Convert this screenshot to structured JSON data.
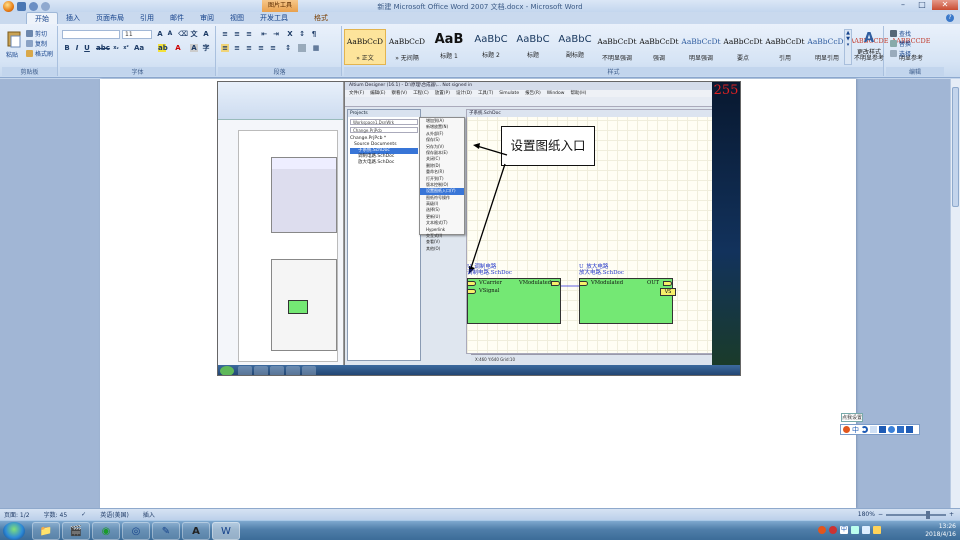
{
  "window": {
    "title": "新建 Microsoft Office Word 2007 文档.docx - Microsoft Word",
    "context_tab_group": "图片工具"
  },
  "ribbon_tabs": [
    "开始",
    "插入",
    "页面布局",
    "引用",
    "邮件",
    "审阅",
    "视图",
    "开发工具",
    "格式"
  ],
  "clipboard": {
    "paste": "粘贴",
    "cut": "剪切",
    "copy": "复制",
    "format_painter": "格式刷",
    "group_label": "剪贴板"
  },
  "font": {
    "size": "11",
    "group_label": "字体"
  },
  "paragraph": {
    "group_label": "段落"
  },
  "styles": {
    "group_label": "样式",
    "change_styles": "更改样式",
    "items": [
      {
        "sample": "AaBbCcD",
        "name": "» 正文",
        "kind": "normal",
        "selected": true
      },
      {
        "sample": "AaBbCcD",
        "name": "» 无间隔",
        "kind": "normal",
        "selected": false
      },
      {
        "sample": "AaB",
        "name": "标题 1",
        "kind": "big",
        "selected": false
      },
      {
        "sample": "AaBbC",
        "name": "标题 2",
        "kind": "big2",
        "selected": false
      },
      {
        "sample": "AaBbC",
        "name": "标题",
        "kind": "big2",
        "selected": false
      },
      {
        "sample": "AaBbC",
        "name": "副标题",
        "kind": "big2",
        "selected": false
      },
      {
        "sample": "AaBbCcDt",
        "name": "不明显强调",
        "kind": "small",
        "selected": false
      },
      {
        "sample": "AaBbCcDt",
        "name": "强调",
        "kind": "small",
        "selected": false
      },
      {
        "sample": "AaBbCcDt",
        "name": "明显强调",
        "kind": "blue",
        "selected": false
      },
      {
        "sample": "AaBbCcDt",
        "name": "要点",
        "kind": "small",
        "selected": false
      },
      {
        "sample": "AaBbCcDt",
        "name": "引用",
        "kind": "small",
        "selected": false
      },
      {
        "sample": "AaBbCcDt",
        "name": "明显引用",
        "kind": "blue",
        "selected": false
      },
      {
        "sample": "AABBCCDE",
        "name": "不明显参考",
        "kind": "red",
        "selected": false
      },
      {
        "sample": "AABBCCDE",
        "name": "明显参考",
        "kind": "red",
        "selected": false
      }
    ]
  },
  "editing": {
    "group_label": "编辑",
    "find": "查找",
    "replace": "替换",
    "select": "选择"
  },
  "screenshot": {
    "ad_title": "Altium Designer (16.1) - D:\\原理\\合成器\\... Not signed in",
    "ad_menu": [
      "文件(F)",
      "编辑(E)",
      "察看(V)",
      "工程(C)",
      "放置(P)",
      "设计(D)",
      "工具(T)",
      "Simulate",
      "报告(R)",
      "Window",
      "帮助(H)"
    ],
    "projects_title": "Projects",
    "workspace_field": "Workspace1.DsnWrk",
    "project_field": "Change.PrjPcb",
    "tree": [
      "Change.PrjPcb *",
      "Source Documents",
      "子系统.SchDoc",
      "调制电路.SchDoc",
      "放大电路.SchDoc"
    ],
    "context_menu": [
      "增加到(A)",
      "新增放置(N)",
      "从外部(F)",
      "保存(S)",
      "另存为(V)",
      "保存副本(E)",
      "关闭(C)",
      "删除(D)",
      "重命名(R)",
      "打开到(T)",
      "版本控制(O)",
      "设置图纸入口(Y)",
      "图纸符号操作",
      "高级(I)",
      "选择(S)",
      "更新(U)",
      "文本格式(T)",
      "Hyperlink",
      "交互式(I)",
      "查看(V)",
      "其他(O)"
    ],
    "highlighted_menu_index": 11,
    "schem_tab": "子系统.SchDoc",
    "callout_text": "设置图纸入口",
    "sheet1": {
      "designator": "U_调制电路",
      "filename": "调制电路.SchDoc",
      "port_left1": "VCarrier",
      "port_left2": "VSignal",
      "port_right": "VModulated"
    },
    "sheet2": {
      "designator": "U_放大电路",
      "filename": "放大电路.SchDoc",
      "port_left": "VModulated",
      "port_right": "OUT"
    },
    "offsheet_port": "VS",
    "red_number": "255",
    "status": "X:460 Y:640   Grid:10"
  },
  "ime": {
    "label": "点我设置",
    "mode": "中"
  },
  "statusbar": {
    "page": "页面: 1/2",
    "words": "字数: 45",
    "language": "英语(美国)",
    "insert_mode": "插入",
    "zoom": "180%"
  },
  "taskbar": {
    "time": "13:26",
    "date": "2018/4/16"
  },
  "colors": {
    "accent": "#15428b",
    "sheet_fill": "#74e874",
    "port_fill": "#f7f06a",
    "highlight": "#3875d7"
  }
}
